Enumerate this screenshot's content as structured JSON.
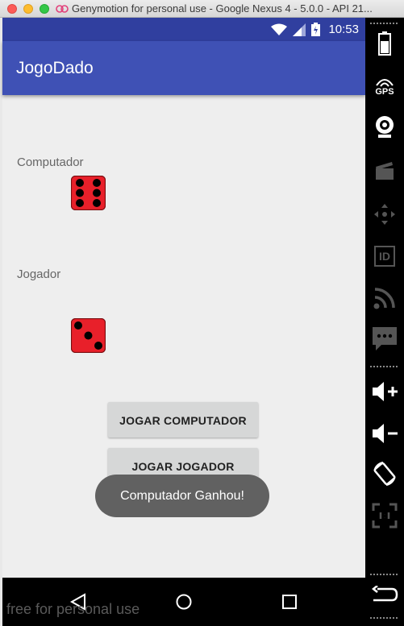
{
  "window": {
    "title": "Genymotion for personal use - Google Nexus 4 - 5.0.0 - API 21..."
  },
  "statusbar": {
    "time": "10:53"
  },
  "app": {
    "title": "JogoDado"
  },
  "computer": {
    "label": "Computador",
    "die_value": 6
  },
  "player": {
    "label": "Jogador",
    "die_value": 3
  },
  "buttons": {
    "play_computer": "JOGAR COMPUTADOR",
    "play_player": "JOGAR JOGADOR"
  },
  "toast": {
    "message": "Computador Ganhou!"
  },
  "watermark": "free for personal use",
  "side_panel": {
    "gps_label": "GPS",
    "id_label": "ID"
  },
  "colors": {
    "primary": "#3f51b5",
    "primary_dark": "#303f9f",
    "die_red": "#e8202a",
    "background": "#eeeeee"
  }
}
